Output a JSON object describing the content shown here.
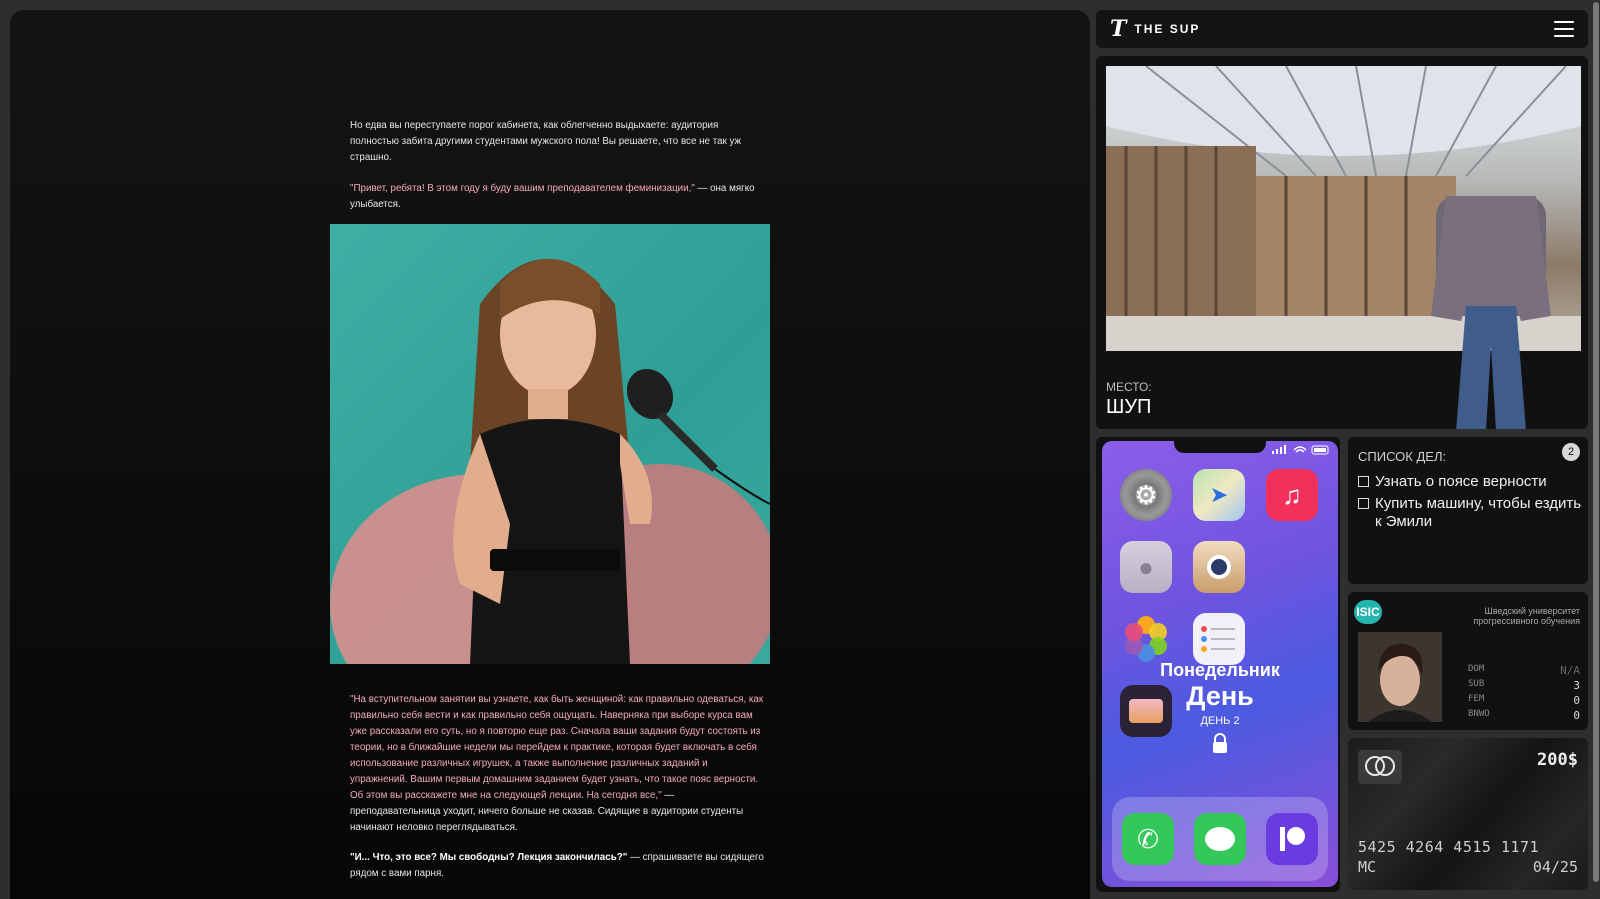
{
  "story": {
    "p1": "Но едва вы переступаете порог кабинета, как облегченно выдыхаете: аудитория полностью забита другими студентами мужского пола! Вы решаете, что все не так уж страшно.",
    "p2_quote": "\"Привет, ребята! В этом году я буду вашим преподавателем феминизации,\"",
    "p2_rest": " — она мягко улыбается.",
    "p3_quote": "\"На вступительном занятии вы узнаете, как быть женщиной: как правильно одеваться, как правильно себя вести и как правильно себя ощущать. Наверняка при выборе курса вам уже рассказали его суть, но я повторю еще раз. Сначала ваши задания будут состоять из теории, но в ближайшие недели мы перейдем к практике, которая будет включать в себя использование различных игрушек, а также выполнение различных заданий и упражнений. Вашим первым домашним заданием будет узнать, что такое пояс верности. Об этом вы расскажете мне на следующей лекции. На сегодня все,\"",
    "p3_rest": " — преподавательница уходит, ничего больше не сказав. Сидящие в аудитории студенты начинают неловко переглядываться.",
    "p4_quote": "\"И... Что, это все? Мы свободны? Лекция закончилась?\"",
    "p4_rest": " — спрашиваете вы сидящего рядом с вами парня."
  },
  "header": {
    "logo_mark": "T",
    "logo_text": "THE SUP"
  },
  "place": {
    "label": "МЕСТО:",
    "value": "ШУП"
  },
  "phone": {
    "weekday": "Понедельник",
    "period": "День",
    "day_label": "ДЕНЬ 2",
    "apps": [
      "settings-app",
      "maps-app",
      "music-app",
      "contacts-app",
      "camera-app",
      "photos-app",
      "reminders-app",
      "wallet-app"
    ],
    "dock": [
      "phone-app",
      "messages-app",
      "patreon-app"
    ]
  },
  "todo": {
    "title": "СПИСОК ДЕЛ:",
    "count": "2",
    "items": [
      "Узнать о поясе верности",
      "Купить машину, чтобы ездить к Эмили"
    ]
  },
  "id_card": {
    "badge": "ISIC",
    "university": "Шведский университет прогрессивного обучения",
    "stats": [
      {
        "label": "DOM",
        "value": "N/A"
      },
      {
        "label": "SUB",
        "value": "3"
      },
      {
        "label": "FEM",
        "value": "0"
      },
      {
        "label": "BNWO",
        "value": "0"
      }
    ]
  },
  "bank_card": {
    "balance": "200$",
    "number": "5425 4264 4515 1171",
    "holder": "MC",
    "expiry": "04/25",
    "brand": "mastercard"
  },
  "colors": {
    "accent_pink": "#f4a9b8",
    "isic_teal": "#23b4ae",
    "phone_purple": "#7a55e2"
  }
}
